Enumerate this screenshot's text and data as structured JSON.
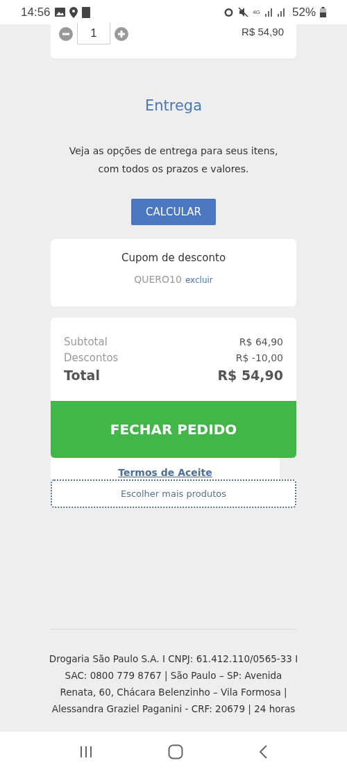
{
  "status_bar": {
    "time": "14:56",
    "battery": "52%",
    "network": "4G"
  },
  "cart_item": {
    "quantity": "1",
    "price": "R$ 54,90"
  },
  "delivery": {
    "title": "Entrega",
    "description": "Veja as opções de entrega para seus itens, com todos os prazos e valores.",
    "button": "CALCULAR"
  },
  "coupon": {
    "title": "Cupom de desconto",
    "code": "QUERO10",
    "remove_link": "excluir"
  },
  "summary": {
    "rows": [
      {
        "kind": "normal",
        "label": "Subtotal",
        "value": "R$ 64,90"
      },
      {
        "kind": "normal",
        "label": "Descontos",
        "value": "R$ -10,00"
      },
      {
        "kind": "total",
        "label": "Total",
        "value": "R$ 54,90"
      }
    ],
    "checkout_button": "FECHAR PEDIDO"
  },
  "terms_link": "Termos de Aceite",
  "more_products_button": "Escolher mais produtos",
  "footer": {
    "text": "Drogaria São Paulo S.A. I CNPJ: 61.412.110/0565-33 I SAC: 0800 779 8767 | São Paulo – SP: Avenida Renata, 60, Chácara Belenzinho – Vila Formosa | Alessandra Graziel Paganini - CRF: 20679 | 24 horas"
  }
}
